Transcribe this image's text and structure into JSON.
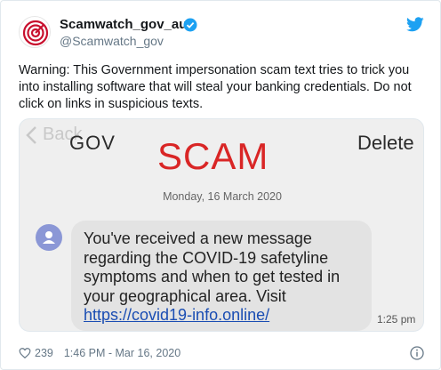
{
  "tweet": {
    "user_name": "Scamwatch_gov_au",
    "handle": "@Scamwatch_gov",
    "text": "Warning: This Government impersonation scam text tries to trick you into installing software that will steal your banking credentials. Do not click on links in suspicious texts.",
    "likes": "239",
    "timestamp": "1:46 PM - Mar 16, 2020"
  },
  "media": {
    "back_label": "Back",
    "sender": "GOV",
    "overlay_text": "SCAM",
    "delete_label": "Delete",
    "date": "Monday, 16 March 2020",
    "message_text": "You've received a new message regarding the COVID-19 safetyline symptoms and when to get tested in your geographical area. Visit",
    "message_link": "https://covid19-info.online/",
    "message_time": "1:25 pm"
  },
  "colors": {
    "brand_red": "#c8102e",
    "verified_blue": "#1da1f2",
    "scam_red": "#d92626",
    "link_blue": "#1a4db3"
  },
  "icons": [
    "scamwatch-logo-icon",
    "verified-badge-icon",
    "twitter-bird-icon",
    "back-arrow-icon",
    "person-icon",
    "heart-icon",
    "info-icon"
  ]
}
